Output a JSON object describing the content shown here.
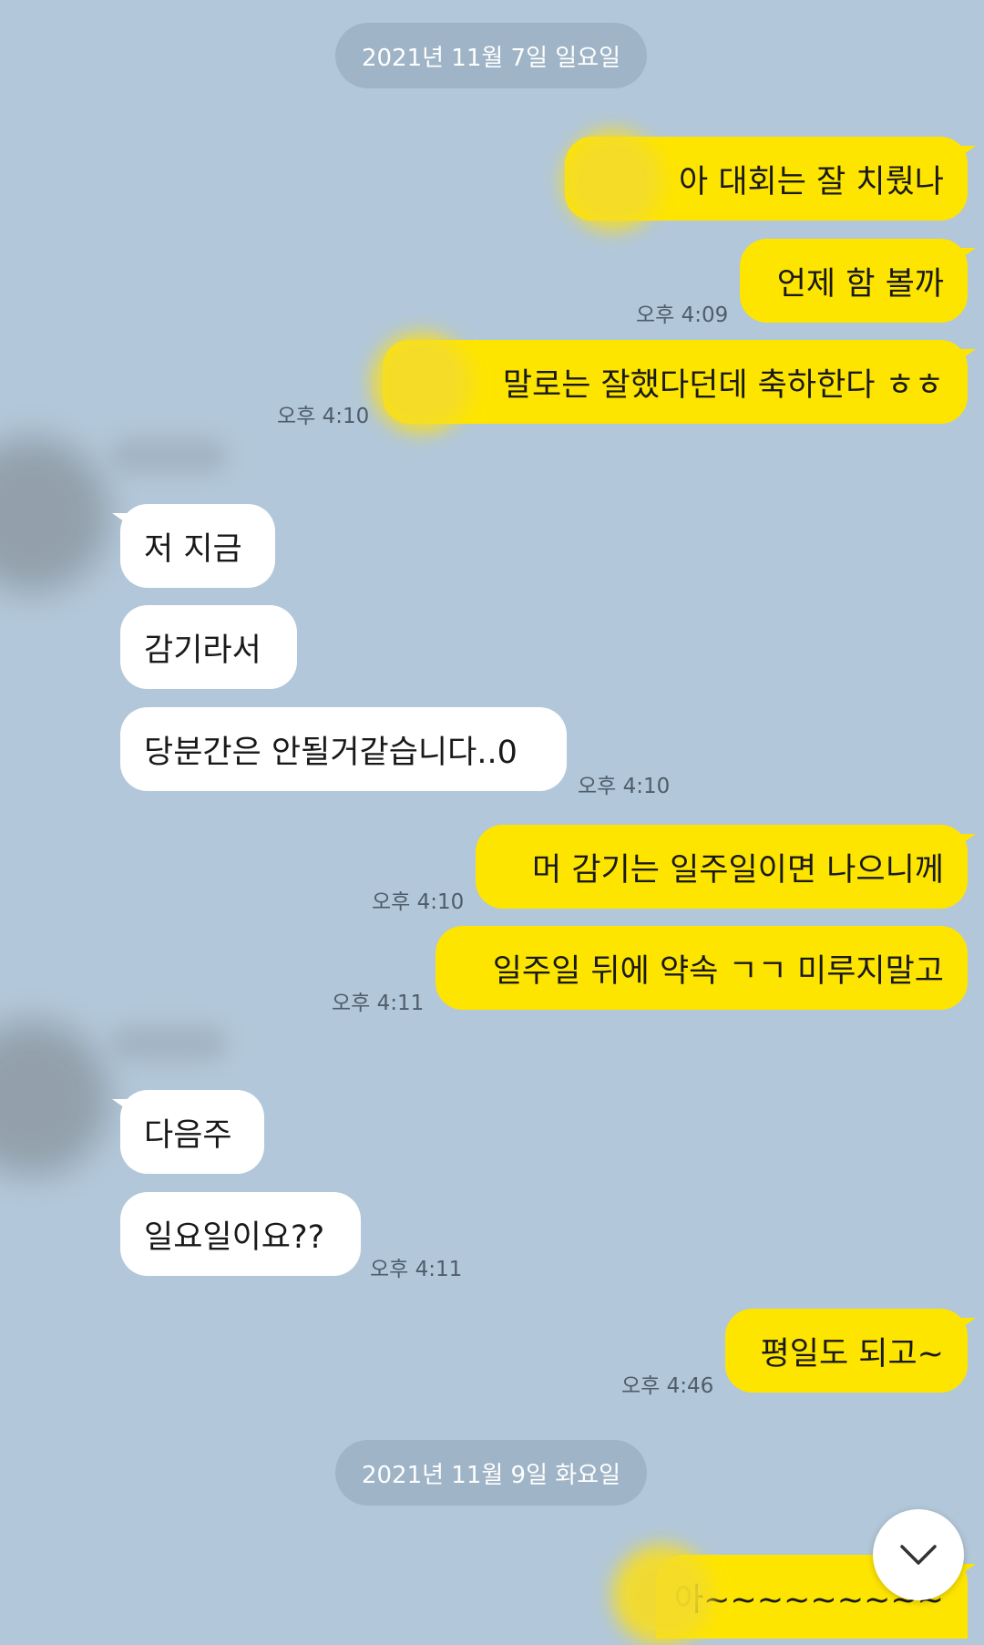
{
  "dates": [
    "2021년 11월 7일 일요일",
    "2021년 11월 9일 화요일"
  ],
  "messages": [
    {
      "text": "아 대회는 잘 치뤘나",
      "time": ""
    },
    {
      "text": "언제 함 볼까",
      "time": "오후 4:09"
    },
    {
      "text": "말로는 잘했다던데 축하한다 ㅎㅎ",
      "time": "오후 4:10"
    },
    {
      "text": "저 지금",
      "time": ""
    },
    {
      "text": "감기라서",
      "time": ""
    },
    {
      "text": "당분간은 안될거같습니다..0",
      "time": "오후 4:10"
    },
    {
      "text": "머 감기는 일주일이면 나으니께",
      "time": "오후 4:10"
    },
    {
      "text": "일주일 뒤에 약속 ㄱㄱ 미루지말고",
      "time": "오후 4:11"
    },
    {
      "text": "다음주",
      "time": ""
    },
    {
      "text": "일요일이요??",
      "time": "오후 4:11"
    },
    {
      "text": "평일도 되고~",
      "time": "오후 4:46"
    },
    {
      "text": "아~~~~~~~~~",
      "time": ""
    }
  ],
  "colors": {
    "background": "#b2c7d9",
    "my_bubble": "#fee500",
    "their_bubble": "#ffffff",
    "date_pill": "#9fb4c6"
  },
  "icons": {
    "scroll_down": "chevron-down-icon"
  }
}
